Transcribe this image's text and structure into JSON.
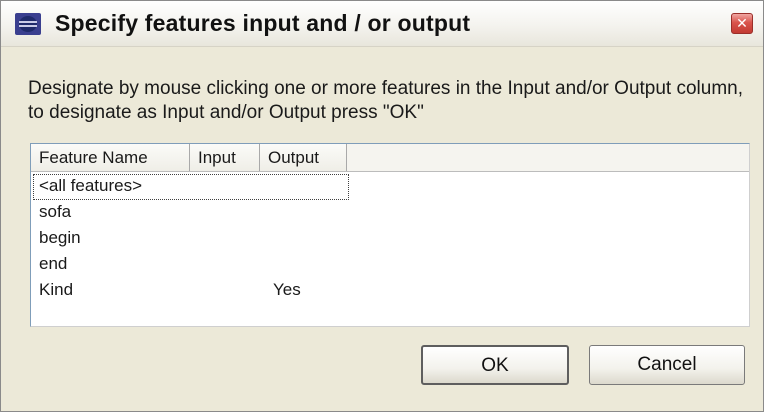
{
  "window": {
    "title": "Specify features input and / or output",
    "app_icon": "eclipse-icon",
    "close_icon": "close-x-icon",
    "close_glyph": "✕"
  },
  "instructions": "Designate by mouse clicking one or more features in the Input and/or Output column, to designate as Input and/or Output press \"OK\"",
  "table": {
    "columns": [
      "Feature Name",
      "Input",
      "Output"
    ],
    "rows": [
      {
        "name": "<all features>",
        "input": "",
        "output": ""
      },
      {
        "name": "sofa",
        "input": "",
        "output": ""
      },
      {
        "name": "begin",
        "input": "",
        "output": ""
      },
      {
        "name": "end",
        "input": "",
        "output": ""
      },
      {
        "name": "Kind",
        "input": "",
        "output": "Yes"
      }
    ]
  },
  "buttons": {
    "ok": "OK",
    "cancel": "Cancel"
  },
  "colors": {
    "dialog_bg": "#ece9d8",
    "close_red": "#d9544c",
    "list_border": "#7f9db9"
  }
}
